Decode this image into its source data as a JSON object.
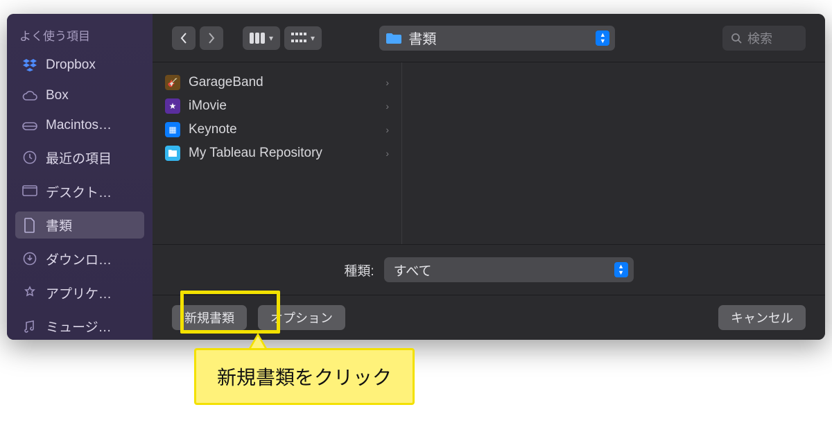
{
  "sidebar": {
    "heading": "よく使う項目",
    "items": [
      {
        "label": "Dropbox",
        "icon": "dropbox",
        "active": false
      },
      {
        "label": "Box",
        "icon": "cloud",
        "active": false
      },
      {
        "label": "Macintos…",
        "icon": "drive",
        "active": false
      },
      {
        "label": "最近の項目",
        "icon": "clock",
        "active": false
      },
      {
        "label": "デスクト…",
        "icon": "desktop",
        "active": false
      },
      {
        "label": "書類",
        "icon": "document",
        "active": true
      },
      {
        "label": "ダウンロ…",
        "icon": "download",
        "active": false
      },
      {
        "label": "アプリケ…",
        "icon": "apps",
        "active": false
      },
      {
        "label": "ミュージ…",
        "icon": "music",
        "active": false
      }
    ]
  },
  "toolbar": {
    "location_label": "書類",
    "search_placeholder": "検索"
  },
  "files": [
    {
      "name": "GarageBand",
      "icon_bg": "#6b4a1b"
    },
    {
      "name": "iMovie",
      "icon_bg": "#5a2e9e"
    },
    {
      "name": "Keynote",
      "icon_bg": "#0a7cff"
    },
    {
      "name": "My Tableau Repository",
      "icon_bg": "#35b7f0"
    }
  ],
  "filter": {
    "label": "種類:",
    "value": "すべて"
  },
  "footer": {
    "new_document_label": "新規書類",
    "options_label": "オプション",
    "cancel_label": "キャンセル"
  },
  "callout_text": "新規書類をクリック"
}
